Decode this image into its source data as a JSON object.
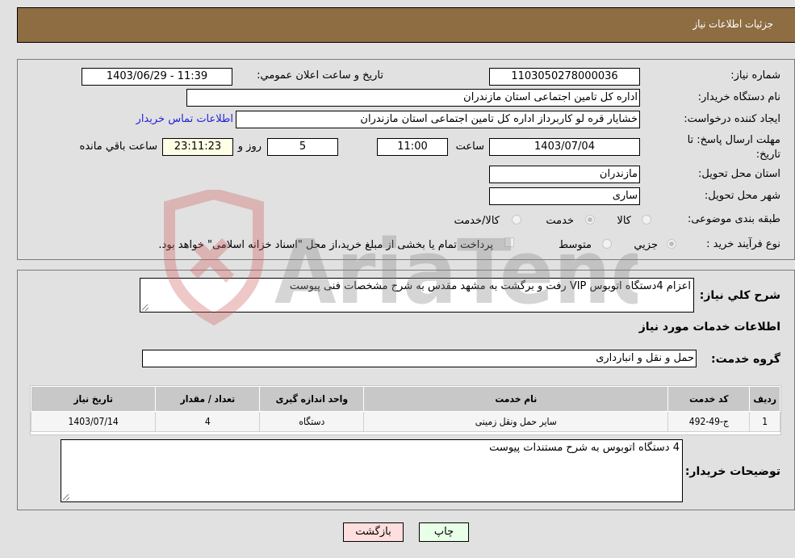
{
  "header": {
    "title": "جزئیات اطلاعات نیاز"
  },
  "need_info": {
    "need_number": {
      "label": "شماره نیاز:",
      "value": "1103050278000036"
    },
    "announce_datetime": {
      "label": "تاریخ و ساعت اعلان عمومي:",
      "value": "1403/06/29 - 11:39"
    },
    "buyer_org": {
      "label": "نام دستگاه خريدار:",
      "value": "اداره کل تامین اجتماعی استان مازندران"
    },
    "requester": {
      "label": "ایجاد کننده درخواست:",
      "value": "خشایار  قره لو کاربرداز اداره کل تامین اجتماعی استان مازندران"
    },
    "buyer_contact_link": "اطلاعات تماس خریدار",
    "deadline": {
      "label": "مهلت ارسال پاسخ: تا تاریخ:",
      "date": "1403/07/04",
      "time_label": "ساعت",
      "time": "11:00",
      "days": "5",
      "days_label": "روز و",
      "remaining": "23:11:23",
      "remaining_label": "ساعت باقي مانده"
    },
    "province": {
      "label": "استان محل تحویل:",
      "value": "مازندران"
    },
    "city": {
      "label": "شهر محل تحویل:",
      "value": "ساری"
    },
    "category": {
      "label": "طبقه بندی موضوعی:",
      "options": [
        {
          "label": "کالا",
          "checked": false
        },
        {
          "label": "خدمت",
          "checked": true
        },
        {
          "label": "کالا/خدمت",
          "checked": false
        }
      ]
    },
    "purchase_type": {
      "label": "نوع فرآیند خرید :",
      "options": [
        {
          "label": "جزيي",
          "checked": true
        },
        {
          "label": "متوسط",
          "checked": false
        }
      ],
      "treasury_checkbox_label": "پرداخت تمام یا بخشی از مبلغ خرید،از محل \"اسناد خزانه اسلامی\" خواهد بود.",
      "treasury_checked": false
    }
  },
  "description": {
    "label": "شرح كلي نياز:",
    "value": "اعزام 4دستگاه اتوبوس VIP رفت و برگشت به مشهد مقدس به شرح مشخصات فنی پیوست"
  },
  "services_section": {
    "title": "اطلاعات خدمات مورد نیاز",
    "group_label": "گروه خدمت:",
    "group_value": "حمل و نقل و انبارداری",
    "table": {
      "columns": [
        "ردیف",
        "کد خدمت",
        "نام خدمت",
        "واحد اندازه گیری",
        "تعداد / مقدار",
        "تاریخ نیاز"
      ],
      "rows": [
        [
          "1",
          "ج-49-492",
          "سایر حمل ونقل زمینی",
          "دستگاه",
          "4",
          "1403/07/14"
        ]
      ]
    }
  },
  "buyer_notes": {
    "label": "توضیحات خریدار:",
    "value": "4 دستگاه اتوبوس به شرح مستندات پیوست"
  },
  "buttons": {
    "print": "چاپ",
    "back": "بازگشت"
  },
  "watermark": {
    "text": "AriaTender.neT"
  },
  "colors": {
    "header_bg": "#8e6d43",
    "print_bg": "#e8ffe8",
    "back_bg": "#ffdede",
    "link": "#2222dd"
  }
}
